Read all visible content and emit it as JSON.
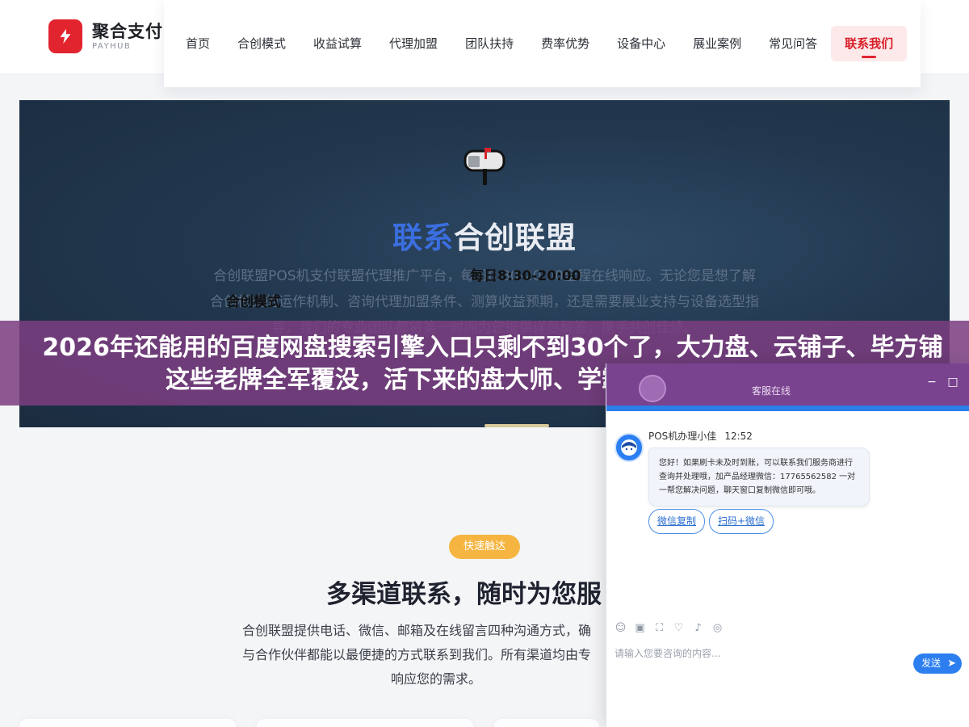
{
  "brand": {
    "name": "聚合支付",
    "sub": "PAYHUB"
  },
  "nav": {
    "items": [
      "首页",
      "合创模式",
      "收益试算",
      "代理加盟",
      "团队扶持",
      "费率优势",
      "设备中心",
      "展业案例",
      "常见问答"
    ],
    "active": "联系我们"
  },
  "hero": {
    "title_highlight": "联系",
    "title_rest": "合创联盟",
    "desc": "合创联盟POS机支付联盟代理推广平台，每日8:30-20:00全程在线响应。无论您是想了解合创模式的运作机制、咨询代理加盟条件、测算收益预期，还是需要展业支持与设备选型指导，我们的专业团队都将第一时间为您提供详尽解答，携手共创佳绩。",
    "hours": "每日8:30-20:00",
    "tooltip": "合创模式"
  },
  "banner": {
    "text": "2026年还能用的百度网盘搜索引擎入口只剩不到30个了，大力盘、云铺子、毕方铺这些老牌全军覆没，活下来的盘大师、学霸盘、网盘俱乐部、"
  },
  "section": {
    "chip": "快速触达",
    "title": "多渠道联系，随时为您服",
    "desc_l1": "合创联盟提供电话、微信、邮箱及在线留言四种沟通方式，确",
    "desc_l2": "与合作伙伴都能以最便捷的方式联系到我们。所有渠道均由专",
    "desc_l3": "响应您的需求。"
  },
  "chat": {
    "header_label": "客服在线",
    "agent": "POS机办理小佳",
    "time": "12:52",
    "message": "您好！如果刷卡未及时到账，可以联系我们服务商进行查询并处理哦，加产品经理微信：17765562582 一对一帮您解决问题，聊天窗口复制微信即可哦。",
    "quick_actions": [
      "微信复制",
      "扫码+微信"
    ],
    "input_placeholder": "请输入您要咨询的内容...",
    "send_label": "发送",
    "tools": [
      "emoji-icon",
      "image-icon",
      "screenshot-icon",
      "rating-icon",
      "voice-icon",
      "chat-history-icon"
    ]
  },
  "colors": {
    "brand_red": "#e2242f",
    "hero_bg": "#22384f",
    "banner": "#7c3e80",
    "chat_accent": "#2d7ff0",
    "chip": "#f5b540"
  }
}
